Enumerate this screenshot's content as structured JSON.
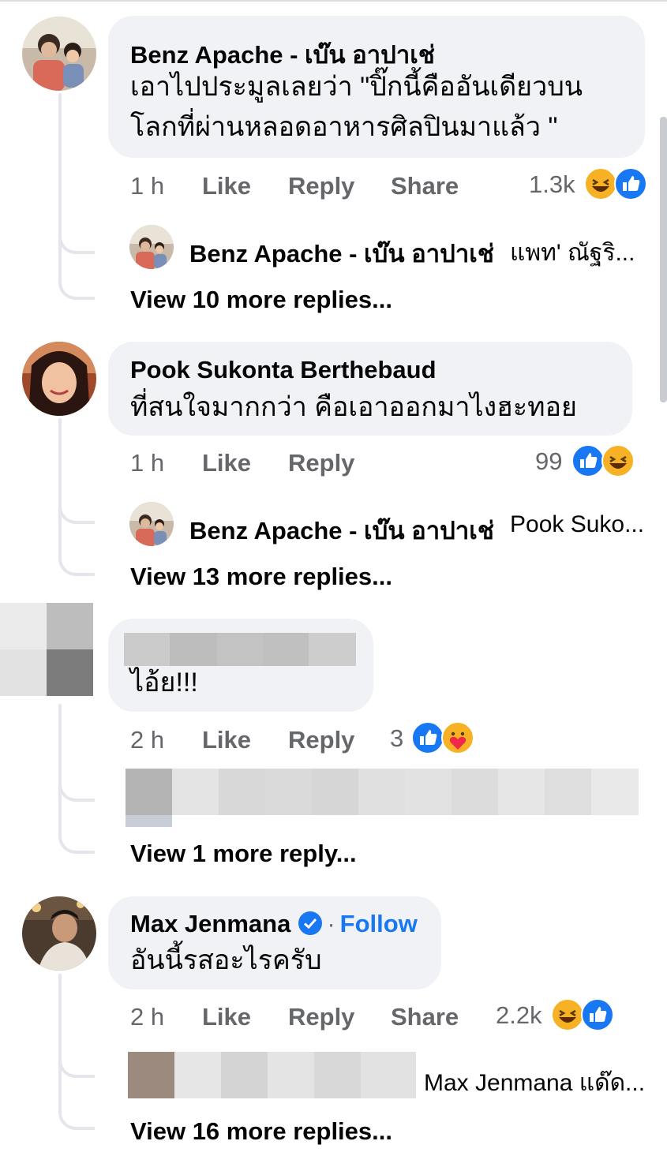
{
  "comments": [
    {
      "author": "Benz Apache - เบ๊น อาปาเช่",
      "text_line1": "เอาไปประมูลเลยว่า \"ปิ๊กนี้คืออันเดียวบน",
      "text_line2": "โลกที่ผ่านหลอดอาหารศิลปินมาแล้ว \"",
      "time": "1 h",
      "like": "Like",
      "reply": "Reply",
      "share": "Share",
      "reaction_count": "1.3k",
      "reactions": [
        "haha",
        "like"
      ],
      "reply_preview_author": "Benz Apache - เบ๊น อาปาเช่",
      "reply_preview_text": "แพท' ณัฐริ...",
      "view_more": "View 10 more replies..."
    },
    {
      "author": "Pook Sukonta Berthebaud",
      "text_line1": "ที่สนใจมากกว่า คือเอาออกมาไงฮะทอย",
      "time": "1 h",
      "like": "Like",
      "reply": "Reply",
      "reaction_count": "99",
      "reactions": [
        "like",
        "haha"
      ],
      "reply_preview_author": "Benz Apache - เบ๊น อาปาเช่",
      "reply_preview_text": "Pook Suko...",
      "view_more": "View 13 more replies..."
    },
    {
      "author": "",
      "text_line1": "ไอ้ย!!!",
      "time": "2 h",
      "like": "Like",
      "reply": "Reply",
      "reaction_count": "3",
      "reactions": [
        "like",
        "care"
      ],
      "view_more": "View 1 more reply..."
    },
    {
      "author": "Max Jenmana",
      "follow": "Follow",
      "separator": "·",
      "text_line1": "อันนี้รสอะไรครับ",
      "time": "2 h",
      "like": "Like",
      "reply": "Reply",
      "share": "Share",
      "reaction_count": "2.2k",
      "reactions": [
        "haha",
        "like"
      ],
      "reply_preview_text": "Max Jenmana แด๊ด...",
      "view_more": "View 16 more replies..."
    }
  ],
  "colors": {
    "bubble": "#f0f2f5",
    "secondary_text": "#65676b",
    "link_blue": "#1877f2",
    "haha_yellow": "#f7b125"
  }
}
